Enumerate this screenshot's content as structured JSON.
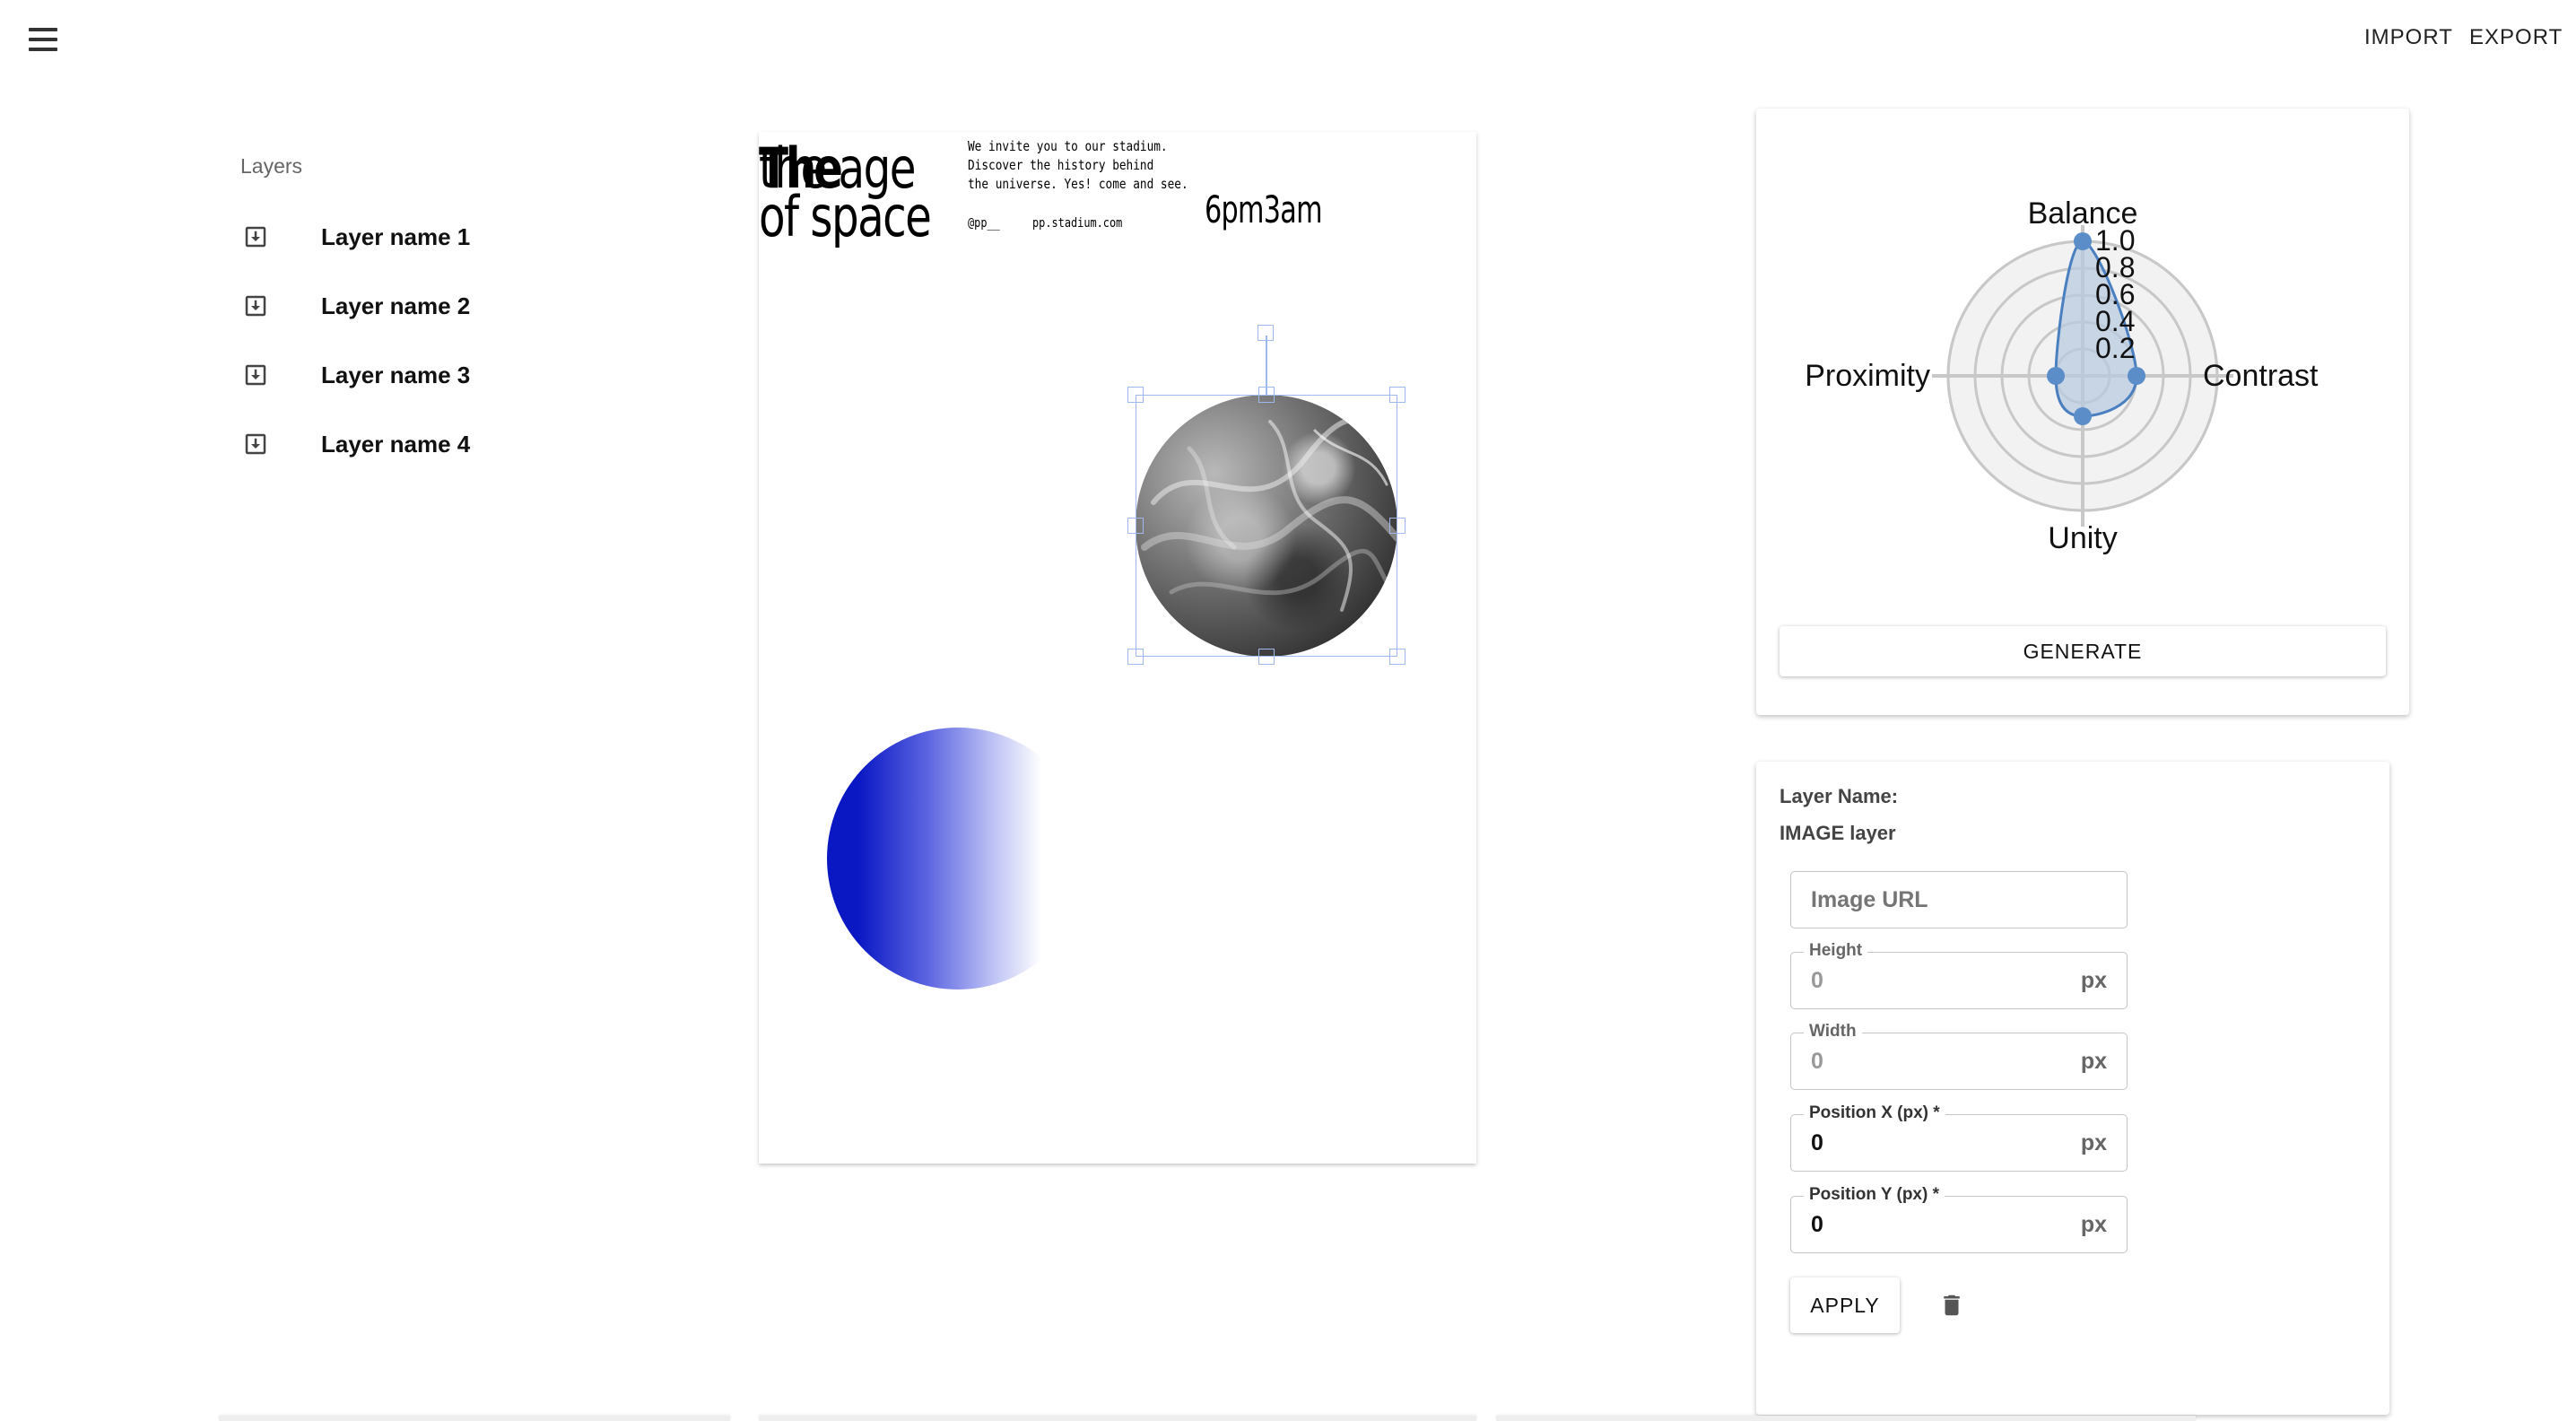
{
  "topbar": {
    "menu_icon": "hamburger-menu-icon",
    "import_label": "IMPORT",
    "export_label": "EXPORT"
  },
  "layers": {
    "title": "Layers",
    "icon": "image-layer-icon",
    "items": [
      {
        "label": "Layer name 1"
      },
      {
        "label": "Layer name 2"
      },
      {
        "label": "Layer name 3"
      },
      {
        "label": "Layer name 4"
      }
    ]
  },
  "poster": {
    "title_overlay": "The",
    "title_line1": "the age",
    "title_line2": "of space",
    "body_line1": "We invite you to our stadium.",
    "body_line2": "Discover the  history behind",
    "body_line3": "the universe. Yes! come and see.",
    "handle": "@pp__",
    "url": "pp.stadium.com",
    "time": "6pm3am",
    "gradient_color": "#0a18c4",
    "selection_color": "#9fb8ee"
  },
  "chart_data": {
    "type": "radar",
    "axes": [
      "Balance",
      "Contrast",
      "Unity",
      "Proximity"
    ],
    "values": [
      1.0,
      0.4,
      0.3,
      0.2
    ],
    "radial_ticks": [
      "0.2",
      "0.4",
      "0.6",
      "0.8",
      "1.0"
    ],
    "rlim": [
      0,
      1.0
    ],
    "series_color": "#4a7fc0",
    "fill_color": "#b7c9e0",
    "grid": true
  },
  "generate_label": "GENERATE",
  "properties": {
    "layer_name_label": "Layer Name:",
    "layer_type": "IMAGE layer",
    "image_url_placeholder": "Image URL",
    "height_label": "Height",
    "height_value": "0",
    "width_label": "Width",
    "width_value": "0",
    "pos_x_label": "Position X (px) *",
    "pos_x_value": "0",
    "pos_y_label": "Position Y (px) *",
    "pos_y_value": "0",
    "unit": "px",
    "apply_label": "APPLY",
    "delete_icon": "trash-icon"
  }
}
